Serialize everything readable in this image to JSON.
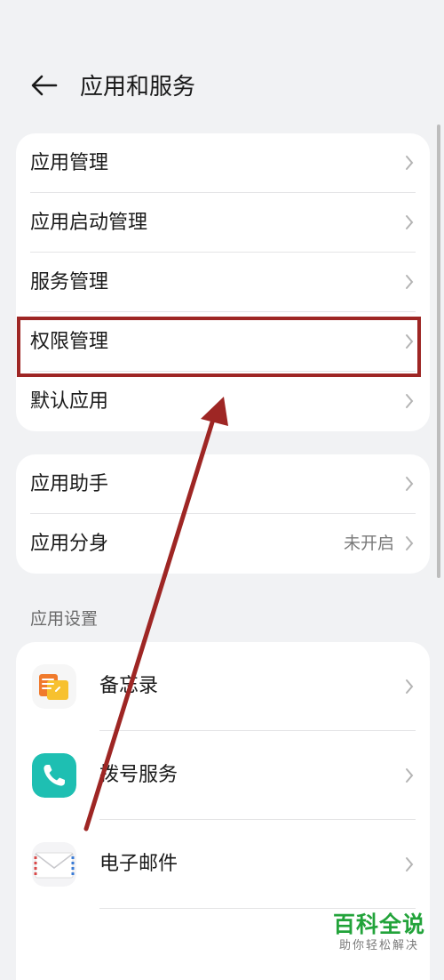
{
  "header": {
    "title": "应用和服务"
  },
  "group1": {
    "items": [
      {
        "label": "应用管理"
      },
      {
        "label": "应用启动管理"
      },
      {
        "label": "服务管理"
      },
      {
        "label": "权限管理"
      },
      {
        "label": "默认应用"
      }
    ]
  },
  "group2": {
    "items": [
      {
        "label": "应用助手"
      },
      {
        "label": "应用分身",
        "value": "未开启"
      }
    ]
  },
  "app_settings": {
    "title": "应用设置",
    "apps": [
      {
        "label": "备忘录",
        "icon": "notepad-icon"
      },
      {
        "label": "拨号服务",
        "icon": "phone-icon"
      },
      {
        "label": "电子邮件",
        "icon": "email-icon"
      }
    ]
  },
  "annotation": {
    "color": "#9e2624"
  },
  "watermark": {
    "main": "百科全说",
    "sub": "助你轻松解决"
  }
}
